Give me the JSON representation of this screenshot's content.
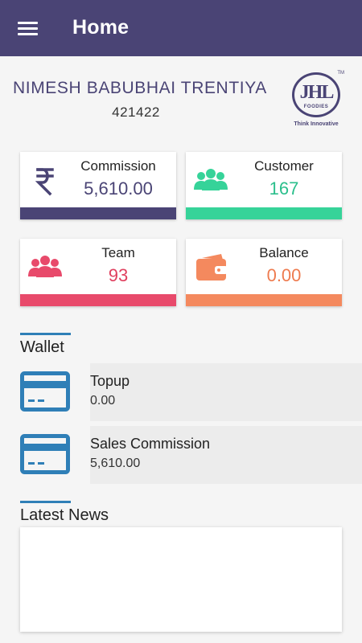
{
  "appbar": {
    "title": "Home"
  },
  "user": {
    "name": "NIMESH BABUBHAI TRENTIYA",
    "id": "421422"
  },
  "logo": {
    "mark": "JHL",
    "sub": "FOODIES",
    "tm": "TM",
    "tagline": "Think Innovative"
  },
  "cards": [
    {
      "label": "Commission",
      "value": "5,610.00",
      "icon": "rupee-icon",
      "accent": "#4a4475",
      "value_color": "#4a4475"
    },
    {
      "label": "Customer",
      "value": "167",
      "icon": "users-icon",
      "accent": "#36d399",
      "value_color": "#2bbf8c"
    },
    {
      "label": "Team",
      "value": "93",
      "icon": "team-icon",
      "accent": "#e84a6b",
      "value_color": "#e0405f"
    },
    {
      "label": "Balance",
      "value": "0.00",
      "icon": "wallet-icon",
      "accent": "#f4895e",
      "value_color": "#ee7b4f"
    }
  ],
  "wallet": {
    "title": "Wallet",
    "items": [
      {
        "title": "Topup",
        "value": "0.00",
        "icon": "credit-card-icon"
      },
      {
        "title": "Sales Commission",
        "value": "5,610.00",
        "icon": "credit-card-icon"
      }
    ]
  },
  "news": {
    "title": "Latest News"
  },
  "colors": {
    "primary": "#4a4475",
    "section_rule": "#2f7fb7",
    "card_icon": "#2f7fb7"
  }
}
